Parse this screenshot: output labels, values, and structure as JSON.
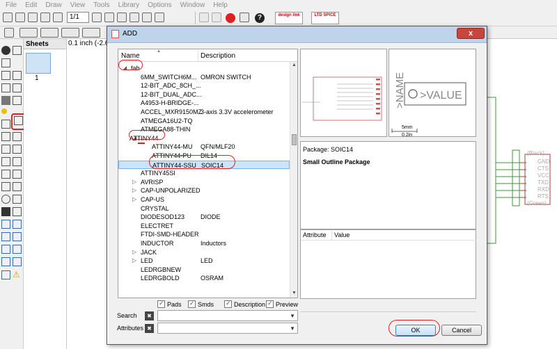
{
  "menu": [
    "File",
    "Edit",
    "Draw",
    "View",
    "Tools",
    "Library",
    "Options",
    "Window",
    "Help"
  ],
  "toolbar": {
    "sheet_value": "1/1",
    "design_link_label": "design link",
    "spice_label": "LTD SPICE"
  },
  "sheets_panel": {
    "tab_label": "Sheets",
    "sheet_number": "1"
  },
  "canvas": {
    "coordinates": "0.1 inch (-2.6 3",
    "connector_labels": [
      "(Black)",
      "GND",
      "CTS",
      "VCC",
      "TXD",
      "RXD",
      "RTS",
      "(Green)"
    ]
  },
  "dialog": {
    "title": "ADD",
    "close_label": "x",
    "tree": {
      "col_name": "Name",
      "col_description": "Description",
      "rows": [
        {
          "name": "fab",
          "desc": "",
          "arrow": "◢"
        },
        {
          "name": "6MM_SWITCH6M...",
          "desc": "OMRON SWITCH",
          "arrow": ""
        },
        {
          "name": "12-BIT_ADC_8CH_...",
          "desc": "",
          "arrow": ""
        },
        {
          "name": "12-BIT_DUAL_ADC...",
          "desc": "",
          "arrow": ""
        },
        {
          "name": "A4953-H-BRIDGE-...",
          "desc": "",
          "arrow": ""
        },
        {
          "name": "ACCEL_MXR9150MZ",
          "desc": "3-axis 3.3V accelerometer",
          "arrow": ""
        },
        {
          "name": "ATMEGA16U2-TQ",
          "desc": "",
          "arrow": ""
        },
        {
          "name": "ATMEGA88-THIN",
          "desc": "",
          "arrow": ""
        },
        {
          "name": "ATTINY44",
          "desc": "",
          "arrow": "◢"
        },
        {
          "name": "ATTINY44-MU",
          "desc": "QFN/MLF20",
          "arrow": ""
        },
        {
          "name": "ATTINY44-PU",
          "desc": "DIL14",
          "arrow": ""
        },
        {
          "name": "ATTINY44-SSU",
          "desc": "SOIC14",
          "arrow": ""
        },
        {
          "name": "ATTINY45SI",
          "desc": "",
          "arrow": ""
        },
        {
          "name": "AVRISP",
          "desc": "",
          "arrow": "▷"
        },
        {
          "name": "CAP-UNPOLARIZED",
          "desc": "",
          "arrow": "▷"
        },
        {
          "name": "CAP-US",
          "desc": "",
          "arrow": "▷"
        },
        {
          "name": "CRYSTAL",
          "desc": "",
          "arrow": ""
        },
        {
          "name": "DIODESOD123",
          "desc": "DIODE",
          "arrow": ""
        },
        {
          "name": "ELECTRET",
          "desc": "",
          "arrow": ""
        },
        {
          "name": "FTDI-SMD-HEADER",
          "desc": "",
          "arrow": ""
        },
        {
          "name": "INDUCTOR",
          "desc": "Inductors",
          "arrow": ""
        },
        {
          "name": "JACK",
          "desc": "",
          "arrow": "▷"
        },
        {
          "name": "LED",
          "desc": "LED",
          "arrow": "▷"
        },
        {
          "name": "LEDRGBNEW",
          "desc": "",
          "arrow": ""
        },
        {
          "name": "LEDRGBOLD",
          "desc": "OSRAM",
          "arrow": ""
        }
      ]
    },
    "checkboxes": [
      "Pads",
      "Smds",
      "Description",
      "Preview"
    ],
    "search_label": "Search",
    "attributes_label": "Attributes",
    "symbol_preview": {
      "name_text": ">NAME",
      "value_text": ">VALUE",
      "scale_mm": "5mm",
      "scale_in": "0.2in"
    },
    "package_label": "Package: SOIC14",
    "package_desc": "Small Outline Package",
    "attr_col_attribute": "Attribute",
    "attr_col_value": "Value",
    "ok_label": "OK",
    "cancel_label": "Cancel",
    "annotation_color": "#e02020",
    "selection_color": "#cce4f7"
  }
}
